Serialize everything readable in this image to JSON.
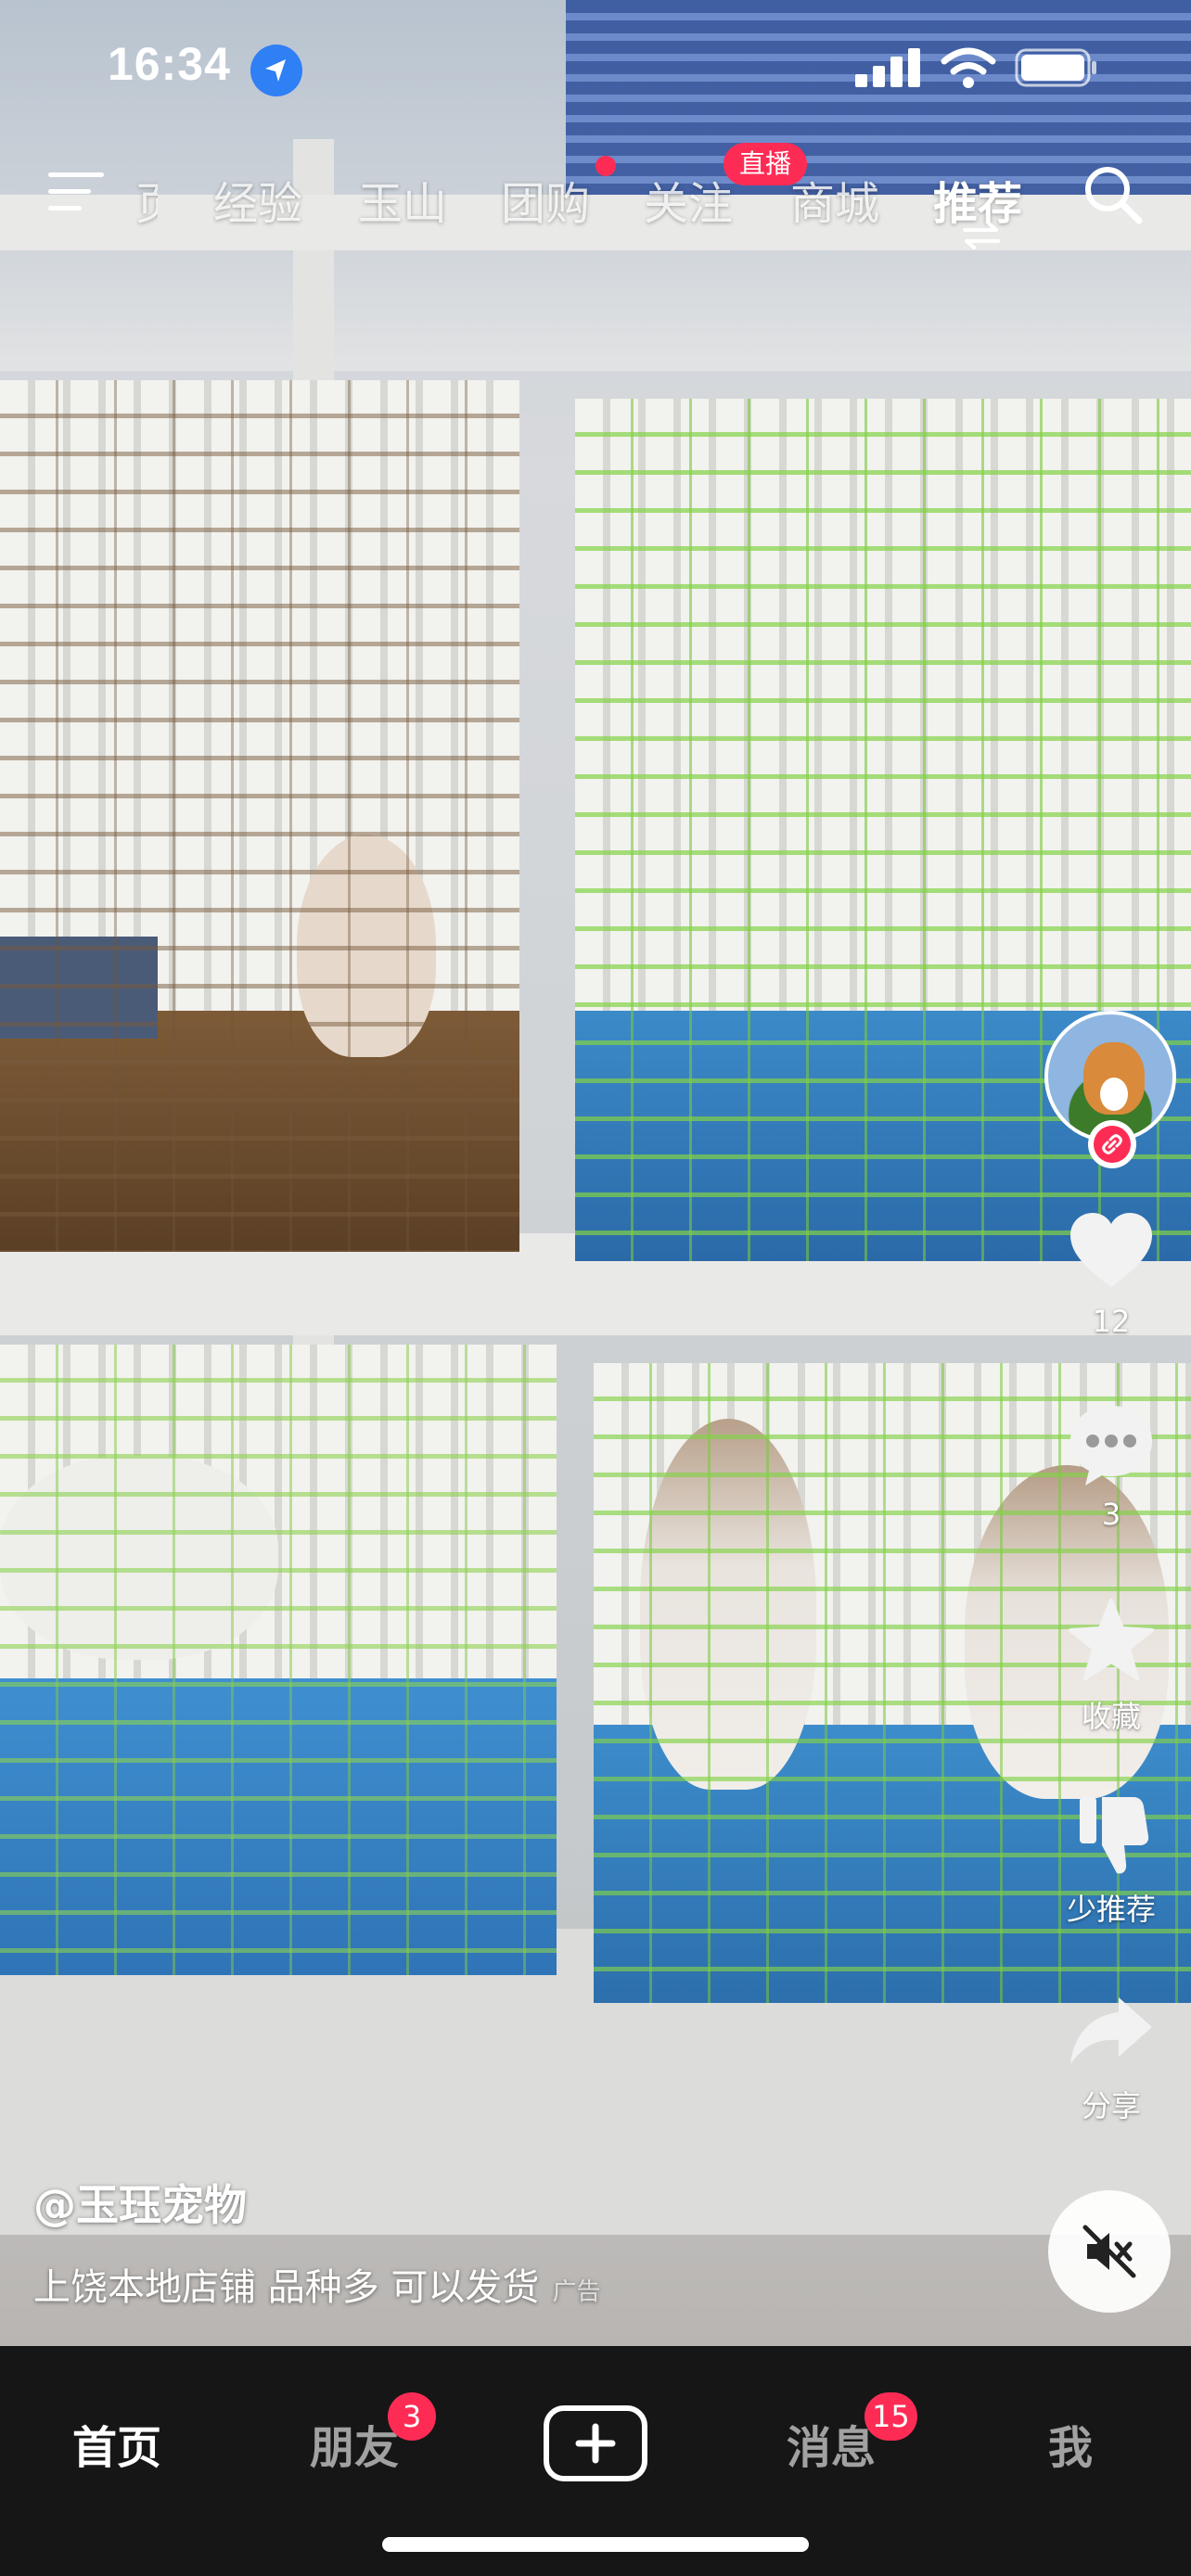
{
  "status_bar": {
    "time": "16:34",
    "icons": [
      "location-arrow-icon",
      "cellular-signal-icon",
      "wifi-icon",
      "battery-icon"
    ]
  },
  "top_nav": {
    "menu_icon": "hamburger-menu-icon",
    "tabs": [
      {
        "label": "页",
        "state": "partially-visible"
      },
      {
        "label": "经验"
      },
      {
        "label": "玉山"
      },
      {
        "label": "团购",
        "has_dot": true
      },
      {
        "label": "关注",
        "badge": "直播"
      },
      {
        "label": "商城"
      },
      {
        "label": "推荐",
        "active": true
      }
    ],
    "search_icon": "search-icon"
  },
  "side_actions": {
    "avatar": "creator-avatar-corgi",
    "like_count": "12",
    "comment_count": "3",
    "favorite_label": "收藏",
    "dislike_label": "少推荐",
    "share_label": "分享"
  },
  "caption": {
    "username": "@玉珏宠物",
    "text": "上饶本地店铺 品种多 可以发货",
    "ad_tag": "广告"
  },
  "bottom_tabs": {
    "home": "首页",
    "friends": "朋友",
    "friends_badge": "3",
    "messages": "消息",
    "messages_badge": "15",
    "me": "我"
  },
  "colors": {
    "accent_red": "#fe2c55",
    "tabbar_bg": "#161616",
    "location_blue": "#2f7ff5"
  }
}
